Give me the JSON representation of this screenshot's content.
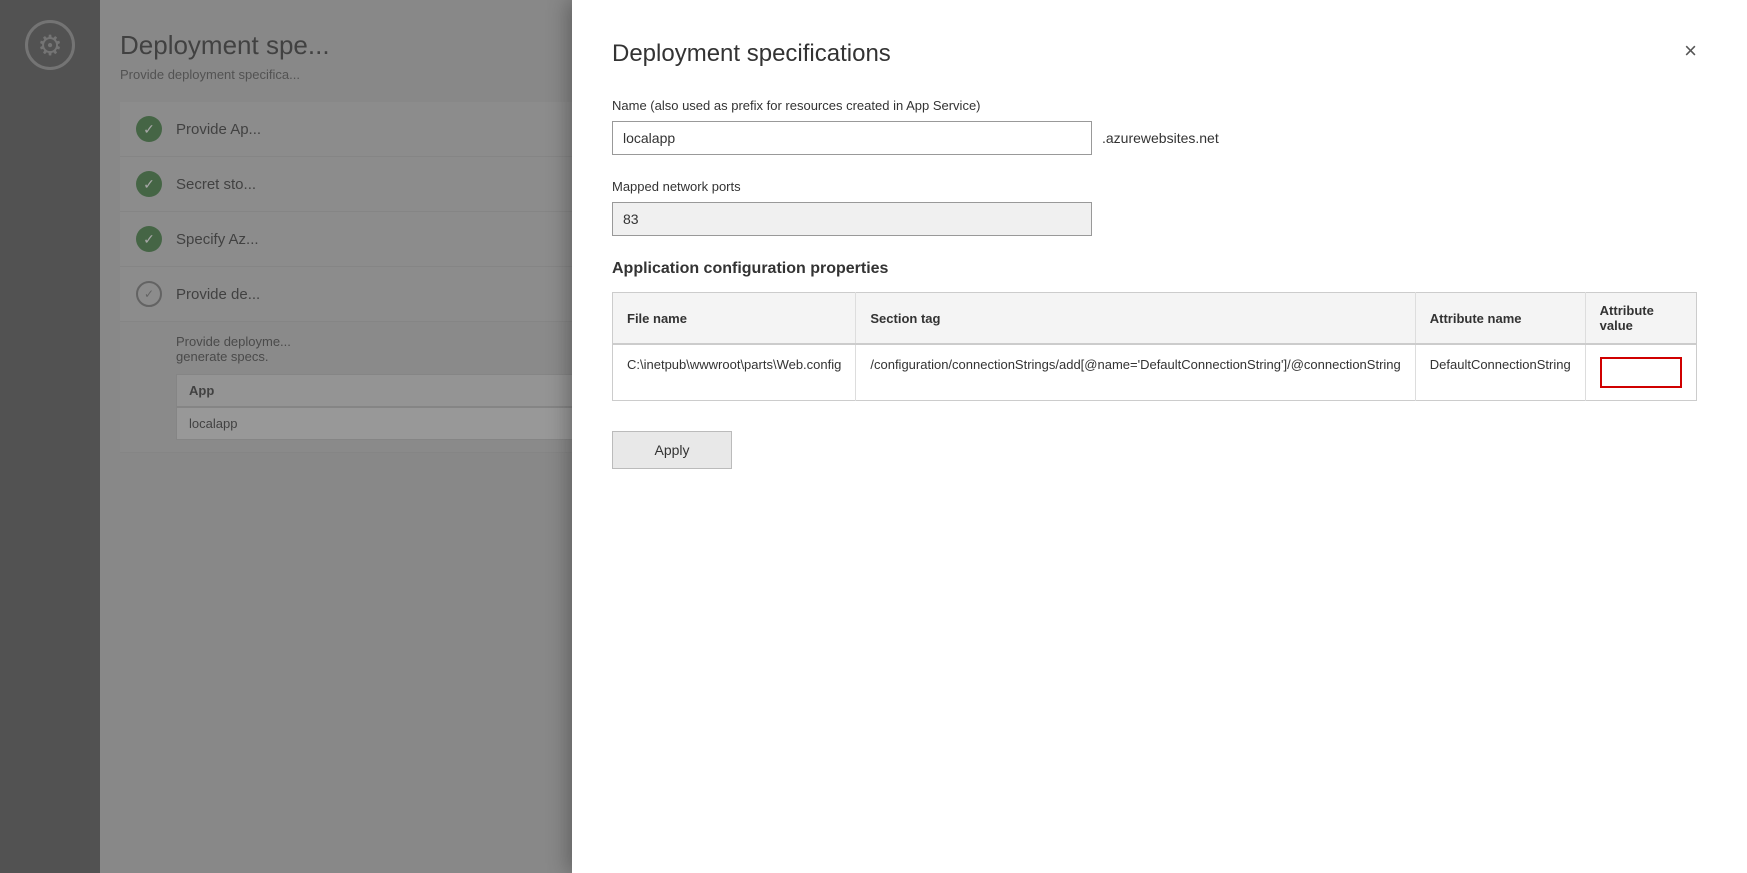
{
  "page": {
    "background": {
      "gear_icon": "⚙",
      "title": "Deployment spe...",
      "subtitle": "Provide deployment specifica...",
      "steps": [
        {
          "id": "step1",
          "label": "Provide Ap...",
          "status": "checked"
        },
        {
          "id": "step2",
          "label": "Secret sto...",
          "status": "checked"
        },
        {
          "id": "step3",
          "label": "Specify Az...",
          "status": "checked"
        },
        {
          "id": "step4",
          "label": "Provide de...",
          "status": "circle"
        }
      ],
      "expanded_desc1": "Provide deployme...",
      "expanded_desc2": "generate specs.",
      "table_col1": "App",
      "table_col2": "",
      "table_row1_c1": "localapp",
      "table_row1_c2": ""
    }
  },
  "modal": {
    "title": "Deployment specifications",
    "close_label": "×",
    "name_label": "Name (also used as prefix for resources created in App Service)",
    "name_value": "localapp",
    "name_suffix": ".azurewebsites.net",
    "ports_label": "Mapped network ports",
    "ports_value": "83",
    "config_section_title": "Application configuration properties",
    "table_headers": {
      "file_name": "File name",
      "section_tag": "Section tag",
      "attribute_name": "Attribute name",
      "attribute_value": "Attribute value"
    },
    "table_rows": [
      {
        "file_name": "C:\\inetpub\\wwwroot\\parts\\Web.config",
        "section_tag": "/configuration/connectionStrings/add[@name='DefaultConnectionString']/@connectionString",
        "attribute_name": "DefaultConnectionString",
        "attribute_value": ""
      }
    ],
    "apply_label": "Apply"
  }
}
